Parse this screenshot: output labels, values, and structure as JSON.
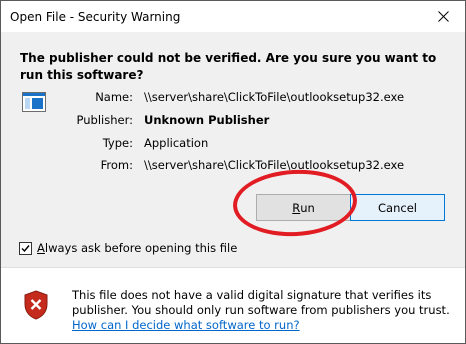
{
  "window": {
    "title": "Open File - Security Warning"
  },
  "headline": "The publisher could not be verified.  Are you sure you want to run this software?",
  "fields": [
    {
      "label": "Name:",
      "value": "\\\\server\\share\\ClickToFile\\outlooksetup32.exe",
      "bold": false
    },
    {
      "label": "Publisher:",
      "value": "Unknown Publisher",
      "bold": true
    },
    {
      "label": "Type:",
      "value": "Application",
      "bold": false
    },
    {
      "label": "From:",
      "value": "\\\\server\\share\\ClickToFile\\outlooksetup32.exe",
      "bold": false
    }
  ],
  "buttons": {
    "run_prefix": "",
    "run_mnemonic": "R",
    "run_suffix": "un",
    "cancel": "Cancel"
  },
  "checkbox": {
    "label_prefix": "",
    "label_mnemonic": "A",
    "label_suffix": "lways ask before opening this file",
    "checked": true
  },
  "warning": {
    "text": "This file does not have a valid digital signature that verifies its publisher.  You should only run software from publishers you trust.",
    "link": "How can I decide what software to run?"
  },
  "colors": {
    "highlight": "#e21c23",
    "link": "#0066cc",
    "shield": "#c42b1c"
  },
  "icons": {
    "close": "close-icon",
    "app": "application-icon",
    "shield": "shield-warning-icon",
    "check": "checkmark-icon"
  }
}
